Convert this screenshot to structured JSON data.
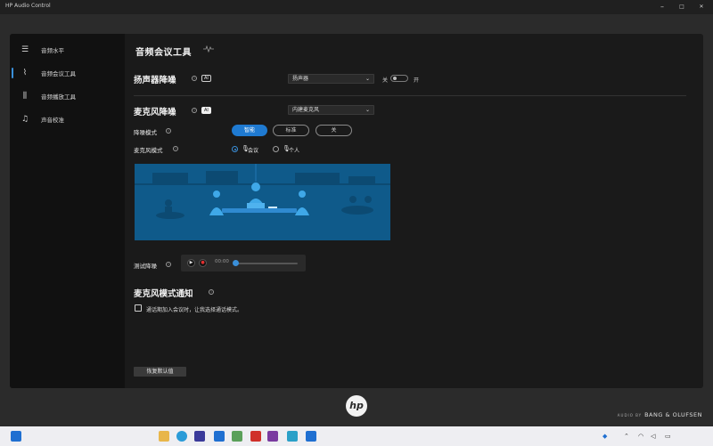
{
  "window": {
    "title": "HP Audio Control",
    "minimize": "–",
    "maximize": "□",
    "close": "✕"
  },
  "sidebar": {
    "items": [
      {
        "label": "音频水平",
        "icon": "sliders-icon",
        "glyph": "☰"
      },
      {
        "label": "音频会议工具",
        "icon": "waveform-icon",
        "glyph": "⌇"
      },
      {
        "label": "音频播放工具",
        "icon": "equalizer-icon",
        "glyph": "⫼"
      },
      {
        "label": "声音校准",
        "icon": "music-note-icon",
        "glyph": "♫"
      }
    ]
  },
  "main": {
    "title": "音频会议工具",
    "speaker": {
      "title": "扬声器降噪",
      "ai_badge": "AI",
      "device": "扬声器",
      "toggle_off_label": "关",
      "toggle_on_label": "开"
    },
    "microphone": {
      "title": "麦克风降噪",
      "ai_badge": "AI",
      "device": "内建麦克风",
      "noise_mode_label": "降噪模式",
      "noise_modes": [
        "智能",
        "标准",
        "关"
      ],
      "noise_mode_selected": "智能",
      "mic_mode_label": "麦克风模式",
      "mic_modes": [
        "会议",
        "个人"
      ],
      "mic_mode_selected": "会议"
    },
    "test": {
      "label": "测试降噪",
      "time": "00:00"
    },
    "notification": {
      "title": "麦克风模式通知",
      "checkbox_label": "通话期加入会议时，让我选择通话模式。",
      "checked": false
    },
    "reset_label": "恢复默认值"
  },
  "brand": {
    "prefix": "AUDIO BY",
    "name": "BANG & OLUFSEN"
  },
  "colors": {
    "accent": "#1f7ad1",
    "illustration": "#0f5a8a"
  }
}
